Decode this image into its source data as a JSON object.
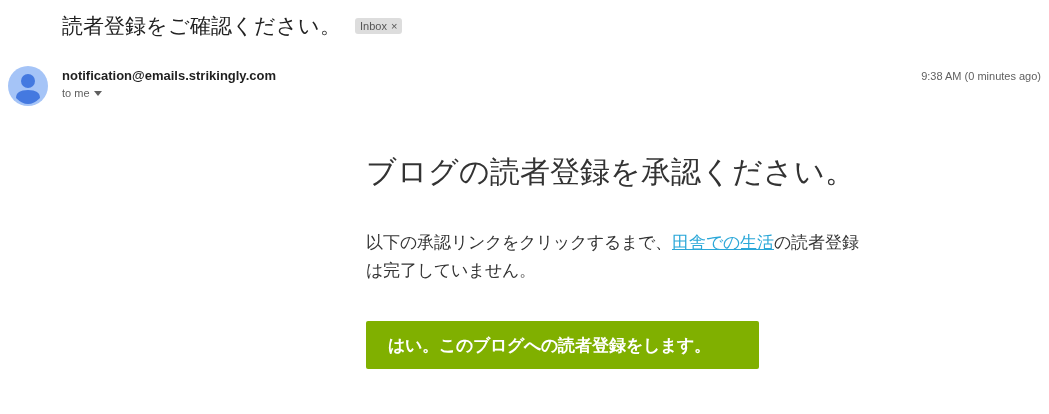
{
  "subject": "読者登録をご確認ください。",
  "label": {
    "text": "Inbox",
    "close": "×"
  },
  "sender": "notification@emails.strikingly.com",
  "recipient": "to me",
  "time": "9:38 AM (0 minutes ago)",
  "body": {
    "heading": "ブログの読者登録を承認ください。",
    "paragraph": {
      "before": "以下の承認リンクをクリックするまで、",
      "link": "田舎での生活",
      "after": "の読者登録は完了していません。"
    },
    "button": "はい。このブログへの読者登録をします。"
  }
}
